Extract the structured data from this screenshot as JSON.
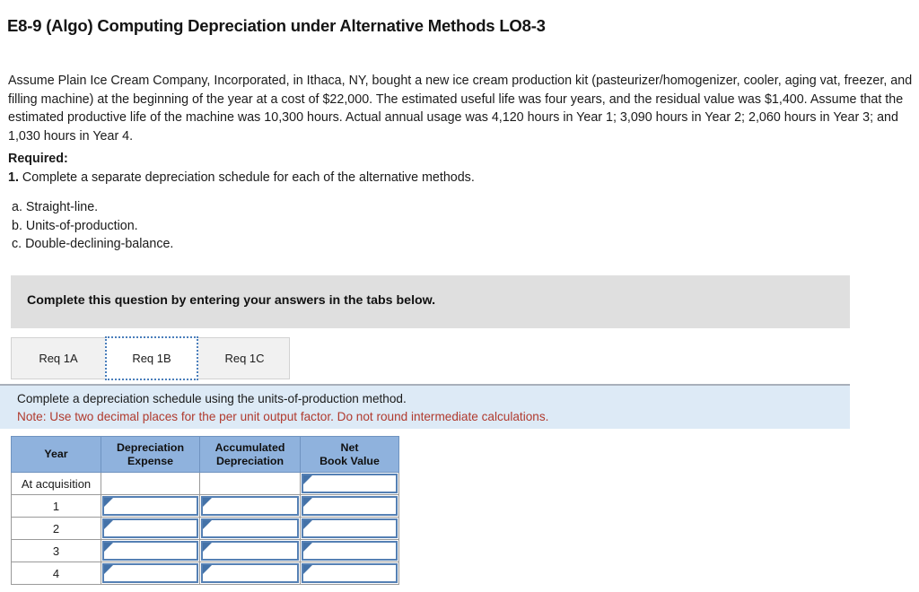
{
  "page_title": "E8-9 (Algo) Computing Depreciation under Alternative Methods LO8-3",
  "scenario": "Assume Plain Ice Cream Company, Incorporated, in Ithaca, NY, bought a new ice cream production kit (pasteurizer/homogenizer, cooler, aging vat, freezer, and filling machine) at the beginning of the year at a cost of $22,000. The estimated useful life was four years, and the residual value was $1,400. Assume that the estimated productive life of the machine was 10,300 hours. Actual annual usage was 4,120 hours in Year 1; 3,090 hours in Year 2; 2,060 hours in Year 3; and 1,030 hours in Year 4.",
  "required": {
    "label": "Required:",
    "item_number": "1.",
    "item_text": "Complete a separate depreciation schedule for each of the alternative methods.",
    "methods": [
      "a. Straight-line.",
      "b. Units-of-production.",
      "c. Double-declining-balance."
    ]
  },
  "instruction_banner": {
    "text": "Complete this question by entering your answers in the tabs below."
  },
  "tabs": [
    {
      "id": "req-1a",
      "label": "Req 1A",
      "selected": false
    },
    {
      "id": "req-1b",
      "label": "Req 1B",
      "selected": true
    },
    {
      "id": "req-1c",
      "label": "Req 1C",
      "selected": false
    }
  ],
  "note_box": {
    "line_1": "Complete a depreciation schedule using the units-of-production method.",
    "line_2": "Note: Use two decimal places for the per unit output factor. Do not round intermediate calculations.",
    "note_color": "#b03a2e",
    "background": "#ddeaf6"
  },
  "schedule_table": {
    "header_color": "#8fb2dd",
    "columns": [
      {
        "key": "year",
        "label": "Year"
      },
      {
        "key": "depreciation_expense",
        "label_line_1": "Depreciation",
        "label_line_2": "Expense"
      },
      {
        "key": "accumulated_depreciation",
        "label_line_1": "Accumulated",
        "label_line_2": "Depreciation"
      },
      {
        "key": "net_book_value",
        "label_line_1": "Net",
        "label_line_2": "Book Value"
      }
    ],
    "rows": [
      {
        "year": "At acquisition",
        "depreciation_expense": {
          "type": "blank",
          "value": ""
        },
        "accumulated_depreciation": {
          "type": "blank",
          "value": ""
        },
        "net_book_value": {
          "type": "input",
          "value": ""
        }
      },
      {
        "year": "1",
        "depreciation_expense": {
          "type": "input",
          "value": ""
        },
        "accumulated_depreciation": {
          "type": "input",
          "value": ""
        },
        "net_book_value": {
          "type": "input",
          "value": ""
        }
      },
      {
        "year": "2",
        "depreciation_expense": {
          "type": "input",
          "value": ""
        },
        "accumulated_depreciation": {
          "type": "input",
          "value": ""
        },
        "net_book_value": {
          "type": "input",
          "value": ""
        }
      },
      {
        "year": "3",
        "depreciation_expense": {
          "type": "input",
          "value": ""
        },
        "accumulated_depreciation": {
          "type": "input",
          "value": ""
        },
        "net_book_value": {
          "type": "input",
          "value": ""
        }
      },
      {
        "year": "4",
        "depreciation_expense": {
          "type": "input",
          "value": ""
        },
        "accumulated_depreciation": {
          "type": "input",
          "value": ""
        },
        "net_book_value": {
          "type": "input",
          "value": ""
        }
      }
    ]
  }
}
